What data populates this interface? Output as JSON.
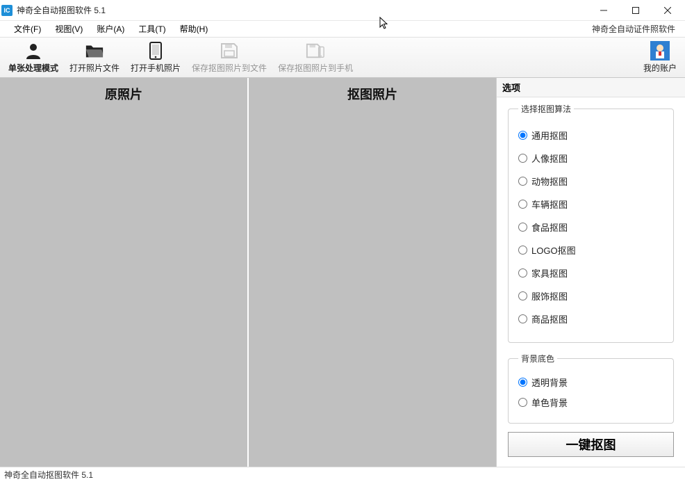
{
  "window": {
    "title": "神奇全自动抠图软件 5.1"
  },
  "menubar": {
    "items": [
      {
        "label": "文件(F)"
      },
      {
        "label": "视图(V)"
      },
      {
        "label": "账户(A)"
      },
      {
        "label": "工具(T)"
      },
      {
        "label": "帮助(H)"
      }
    ],
    "right_label": "神奇全自动证件照软件"
  },
  "toolbar": {
    "buttons": [
      {
        "id": "mode",
        "label": "单张处理模式",
        "icon": "person-icon",
        "enabled": true,
        "selected": true
      },
      {
        "id": "open-file",
        "label": "打开照片文件",
        "icon": "folder-icon",
        "enabled": true
      },
      {
        "id": "open-phone",
        "label": "打开手机照片",
        "icon": "phone-icon",
        "enabled": true
      },
      {
        "id": "save-file",
        "label": "保存抠图照片到文件",
        "icon": "save-icon",
        "enabled": false
      },
      {
        "id": "save-phone",
        "label": "保存抠图照片到手机",
        "icon": "save-phone-icon",
        "enabled": false
      }
    ],
    "account": {
      "label": "我的账户"
    }
  },
  "panels": {
    "original": "原照片",
    "result": "抠图照片"
  },
  "options": {
    "header": "选项",
    "algorithm": {
      "legend": "选择抠图算法",
      "selected": 0,
      "items": [
        "通用抠图",
        "人像抠图",
        "动物抠图",
        "车辆抠图",
        "食品抠图",
        "LOGO抠图",
        "家具抠图",
        "服饰抠图",
        "商品抠图"
      ]
    },
    "background": {
      "legend": "背景底色",
      "selected": 0,
      "items": [
        "透明背景",
        "单色背景"
      ]
    },
    "action_label": "一键抠图"
  },
  "statusbar": {
    "text": "神奇全自动抠图软件 5.1"
  }
}
